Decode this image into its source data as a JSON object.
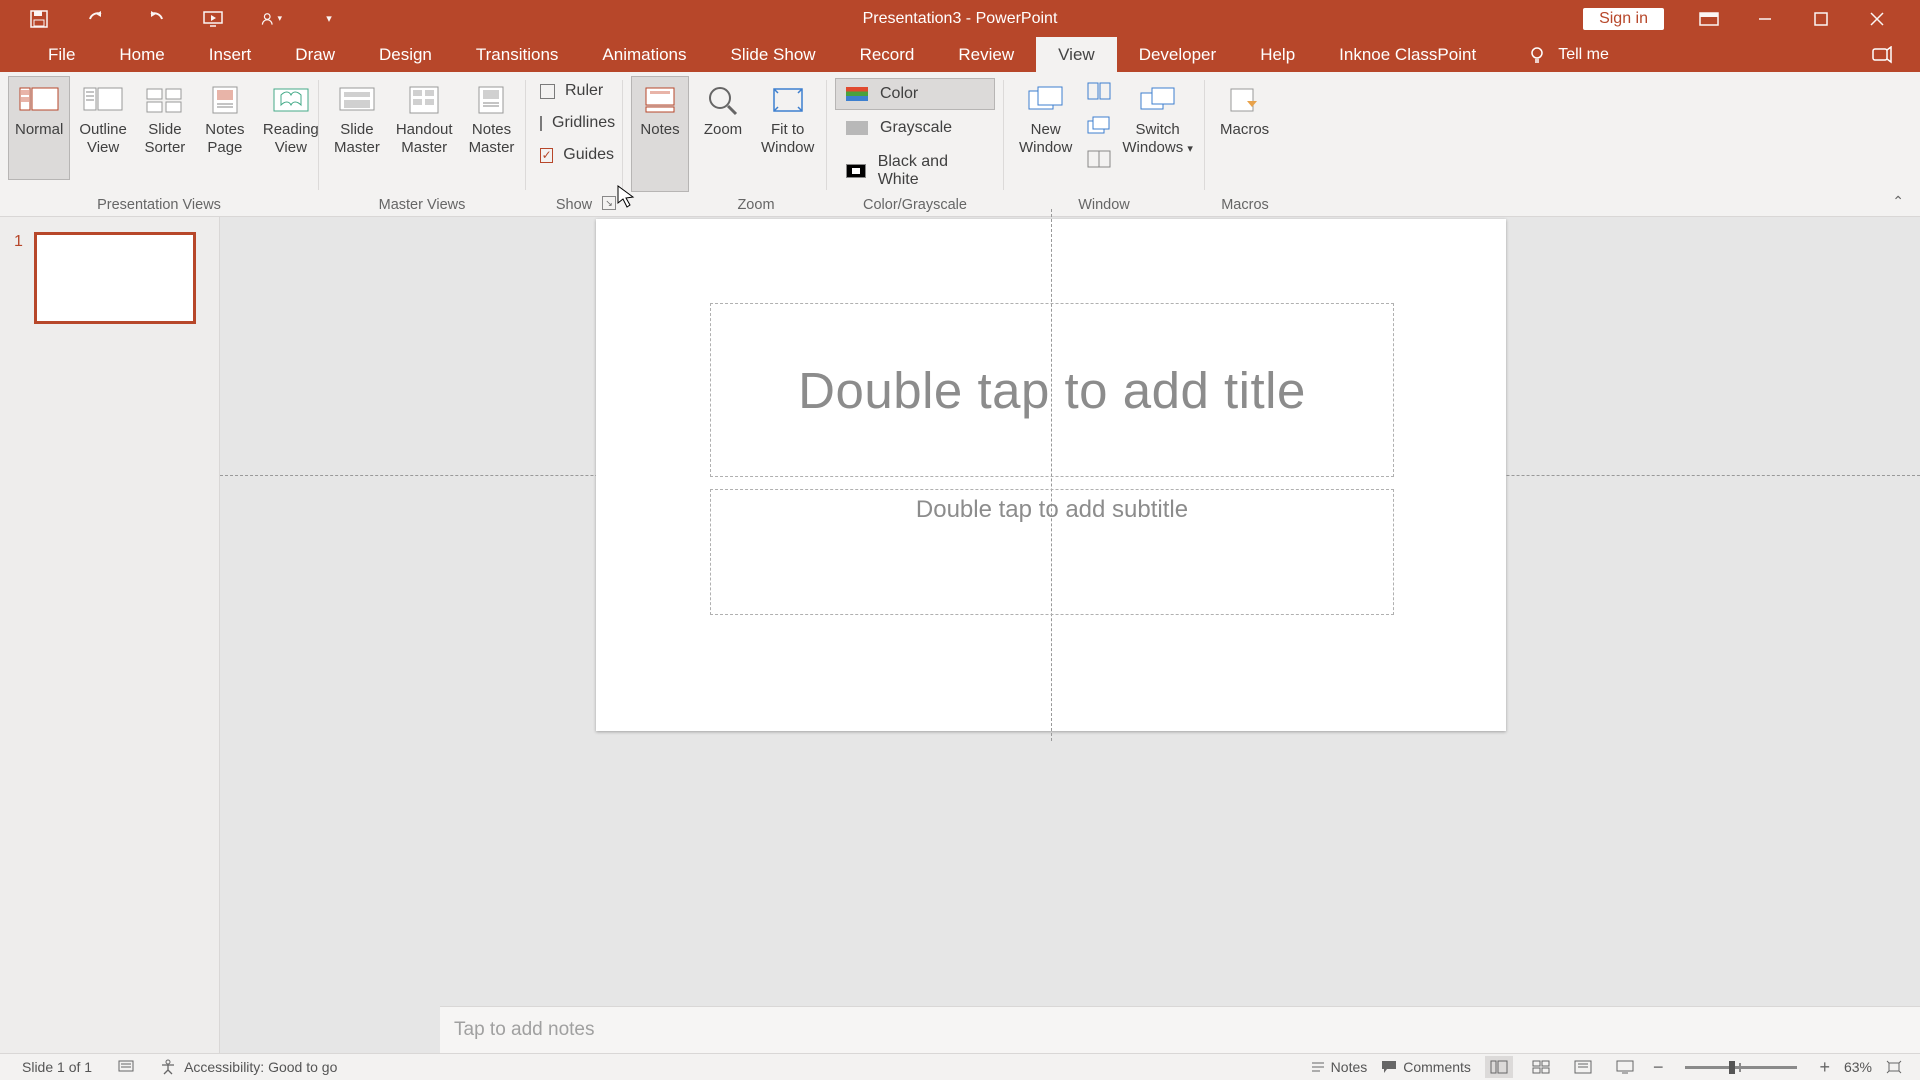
{
  "app_title": "Presentation3  -  PowerPoint",
  "signin": "Sign in",
  "tabs": [
    "File",
    "Home",
    "Insert",
    "Draw",
    "Design",
    "Transitions",
    "Animations",
    "Slide Show",
    "Record",
    "Review",
    "View",
    "Developer",
    "Help",
    "Inknoe ClassPoint"
  ],
  "active_tab": "View",
  "tell_me": "Tell me",
  "ribbon": {
    "presentation_views": {
      "label": "Presentation Views",
      "normal": "Normal",
      "outline": "Outline\nView",
      "sorter": "Slide\nSorter",
      "notespage": "Notes\nPage",
      "reading": "Reading\nView"
    },
    "master_views": {
      "label": "Master Views",
      "slide": "Slide\nMaster",
      "handout": "Handout\nMaster",
      "notes": "Notes\nMaster"
    },
    "show": {
      "label": "Show",
      "ruler": "Ruler",
      "gridlines": "Gridlines",
      "guides": "Guides"
    },
    "notes_btn": "Notes",
    "zoom": {
      "label": "Zoom",
      "zoom": "Zoom",
      "fit": "Fit to\nWindow"
    },
    "colorgray": {
      "label": "Color/Grayscale",
      "color": "Color",
      "gray": "Grayscale",
      "bw": "Black and White"
    },
    "window": {
      "label": "Window",
      "neww": "New\nWindow",
      "switch": "Switch\nWindows"
    },
    "macros": {
      "label": "Macros",
      "macros": "Macros"
    }
  },
  "slide": {
    "num": "1",
    "title_placeholder": "Double tap to add title",
    "subtitle_placeholder": "Double tap to add subtitle",
    "notes_placeholder": "Tap to add notes"
  },
  "status": {
    "slide_count": "Slide 1 of 1",
    "accessibility": "Accessibility: Good to go",
    "notes": "Notes",
    "comments": "Comments",
    "zoom": "63%"
  }
}
